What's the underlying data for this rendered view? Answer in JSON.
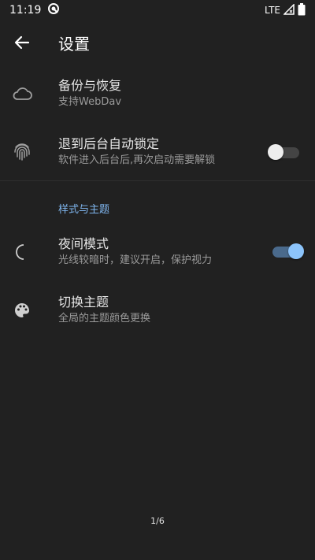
{
  "status_bar": {
    "time": "11:19",
    "network": "LTE"
  },
  "app_bar": {
    "title": "设置"
  },
  "settings": [
    {
      "title": "备份与恢复",
      "subtitle": "支持WebDav"
    },
    {
      "title": "退到后台自动锁定",
      "subtitle": "软件进入后台后,再次启动需要解锁",
      "toggle_on": false
    }
  ],
  "section": {
    "header": "样式与主题"
  },
  "theme_settings": [
    {
      "title": "夜间模式",
      "subtitle": "光线较暗时，建议开启，保护视力",
      "toggle_on": true
    },
    {
      "title": "切换主题",
      "subtitle": "全局的主题颜色更换"
    }
  ],
  "page_indicator": "1/6",
  "colors": {
    "accent": "#7fb6ef",
    "background": "#212121"
  }
}
